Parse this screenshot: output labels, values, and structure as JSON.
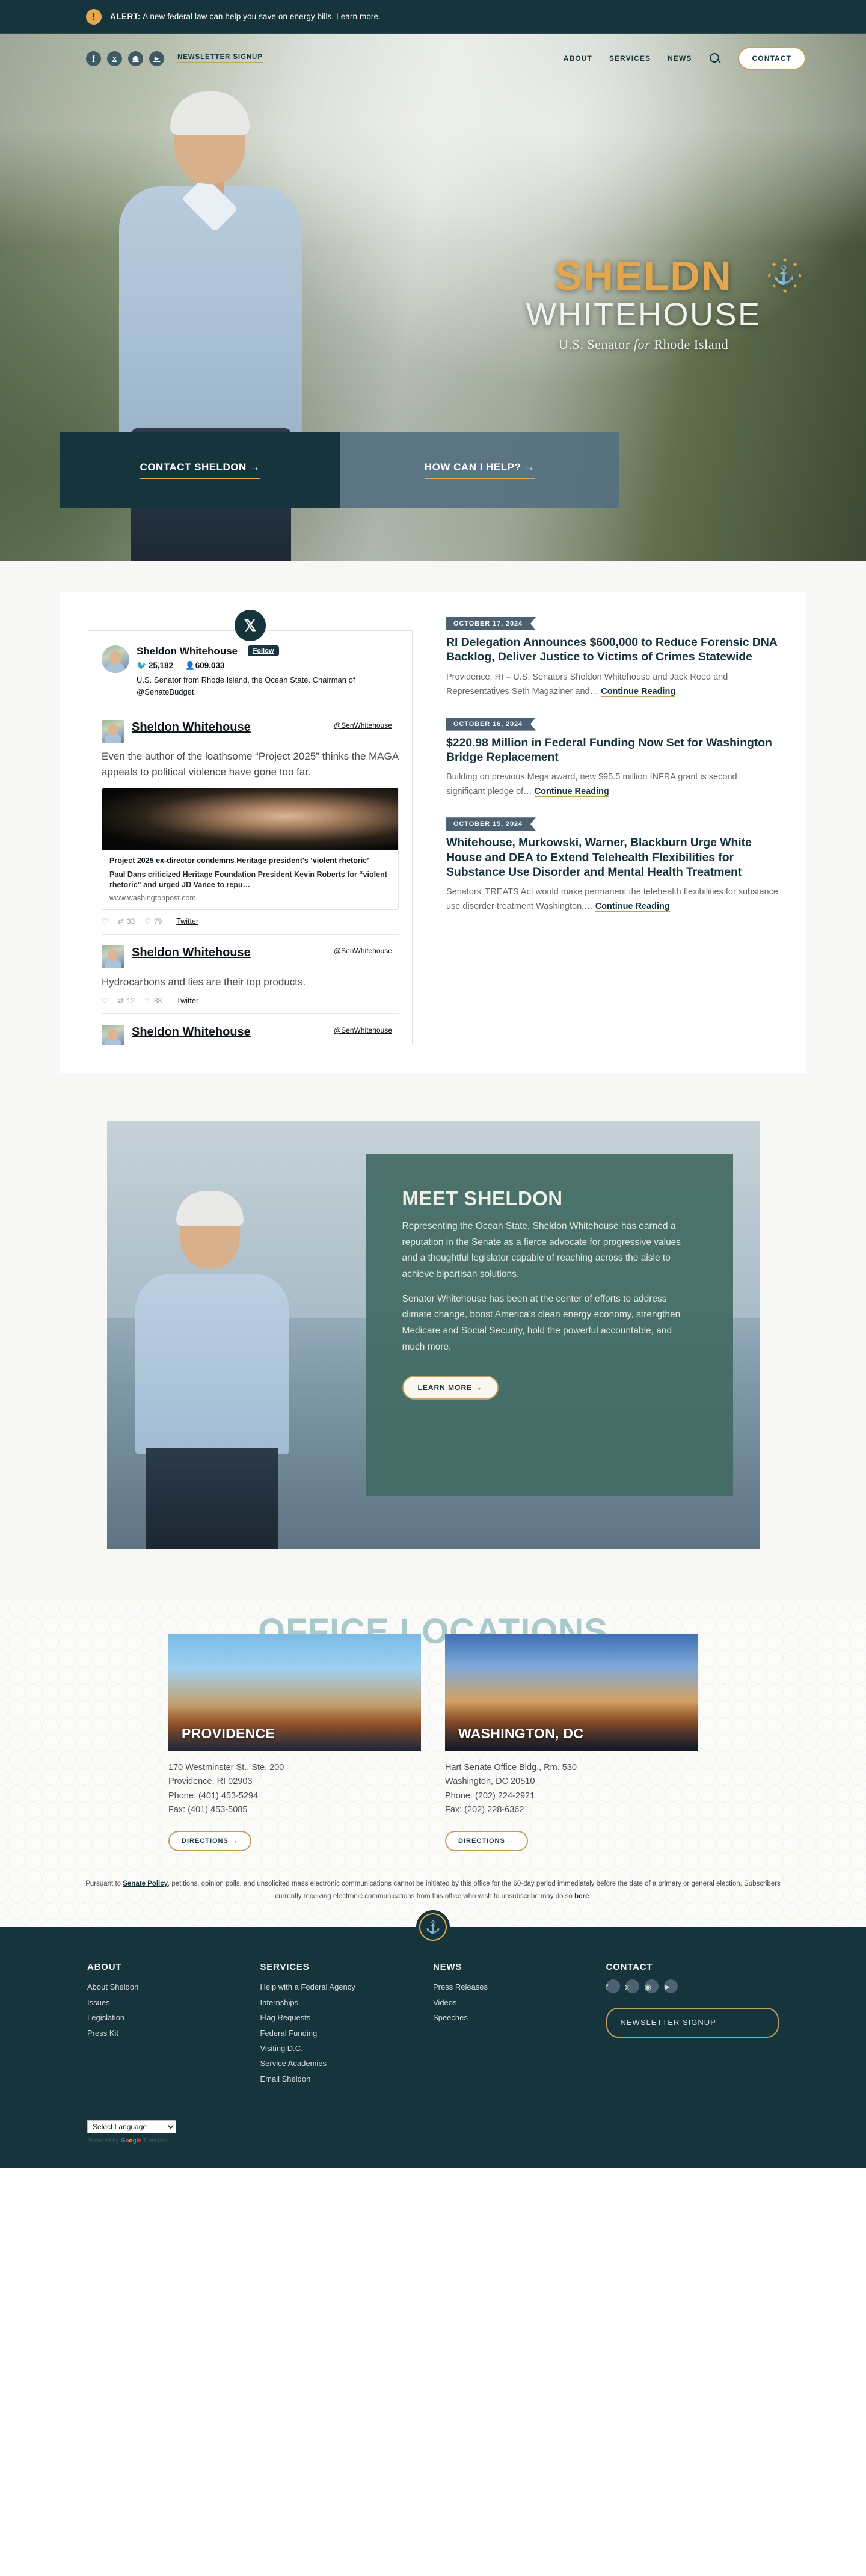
{
  "alert": {
    "icon": "exclamation-icon",
    "label": "ALERT:",
    "message": " A new federal law can help you save on energy bills. Learn more."
  },
  "nav": {
    "social": [
      {
        "name": "facebook-icon",
        "glyph": "f"
      },
      {
        "name": "x-icon",
        "glyph": "✕"
      },
      {
        "name": "instagram-icon",
        "glyph": "◎"
      },
      {
        "name": "youtube-icon",
        "glyph": "▶"
      }
    ],
    "newsletter_label": "NEWSLETTER SIGNUP",
    "items": [
      "ABOUT",
      "SERVICES",
      "NEWS"
    ],
    "search_icon": "search-icon",
    "contact_label": "CONTACT"
  },
  "hero": {
    "first_name": "SHELD",
    "first_name_tail": "N",
    "last_name": "WHITEHOUSE",
    "tagline_prefix": "U.S. Senator ",
    "tagline_italic": "for",
    "tagline_suffix": " Rhode Island",
    "cta_primary": "CONTACT SHELDON →",
    "cta_secondary": "HOW CAN I HELP? →"
  },
  "twitter": {
    "logo": "x-logo-icon",
    "profile": {
      "name": "Sheldon Whitehouse",
      "follow_label": "Follow",
      "tweets_count": "25,182",
      "followers_count": "609,033",
      "bio": "U.S. Senator from Rhode Island, the Ocean State. Chairman of @SenateBudget."
    },
    "tweets": [
      {
        "name": "Sheldon Whitehouse",
        "handle": "@SenWhitehouse",
        "text": "Even the author of the loathsome “Project 2025” thinks the MAGA appeals to political violence have gone too far.",
        "card": {
          "title": "Project 2025 ex-director condemns Heritage president's ‘violent rhetoric’",
          "desc": "Paul Dans criticized Heritage Foundation President Kevin Roberts for “violent rhetoric” and urged JD Vance to repu…",
          "url": "www.washingtonpost.com"
        },
        "retweets": "33",
        "likes": "79",
        "source": "Twitter"
      },
      {
        "name": "Sheldon Whitehouse",
        "handle": "@SenWhitehouse",
        "text": "Hydrocarbons and lies are their top products.",
        "retweets": "12",
        "likes": "88",
        "source": "Twitter"
      },
      {
        "name": "Sheldon Whitehouse",
        "handle": "@SenWhitehouse"
      }
    ]
  },
  "news": [
    {
      "date": "OCTOBER 17, 2024",
      "title": "RI Delegation Announces $600,000 to Reduce Forensic DNA Backlog, Deliver Justice to Victims of Crimes Statewide",
      "excerpt": "Providence, RI – U.S. Senators Sheldon Whitehouse and Jack Reed and Representatives Seth Magaziner and… ",
      "continue_label": "Continue Reading"
    },
    {
      "date": "OCTOBER 16, 2024",
      "title": "$220.98 Million in Federal Funding Now Set for Washington Bridge Replacement",
      "excerpt": "Building on previous Mega award, new $95.5 million INFRA grant is second significant pledge of… ",
      "continue_label": "Continue Reading"
    },
    {
      "date": "OCTOBER 15, 2024",
      "title": "Whitehouse, Murkowski, Warner, Blackburn Urge White House and DEA to Extend Telehealth Flexibilities for Substance Use Disorder and Mental Health Treatment",
      "excerpt": "Senators' TREATS Act would make permanent the telehealth flexibilities for substance use disorder treatment Washington,… ",
      "continue_label": "Continue Reading"
    }
  ],
  "meet": {
    "title": "MEET SHELDON",
    "paragraph1": "Representing the Ocean State, Sheldon Whitehouse has earned a reputation in the Senate as a fierce advocate for progressive values and a thoughtful legislator capable of reaching across the aisle to achieve bipartisan solutions.",
    "paragraph2": "Senator Whitehouse has been at the center of efforts to address climate change, boost America's clean energy economy, strengthen Medicare and Social Security, hold the powerful accountable, and much more.",
    "button_label": "LEARN MORE →"
  },
  "offices": {
    "heading": "OFFICE LOCATIONS",
    "items": [
      {
        "city": "PROVIDENCE",
        "address": "170 Westminster St., Ste. 200\nProvidence, RI 02903\nPhone: (401) 453-5294\nFax: (401) 453-5085",
        "button_label": "DIRECTIONS →"
      },
      {
        "city": "WASHINGTON, DC",
        "address": "Hart Senate Office Bldg., Rm. 530\nWashington, DC 20510\nPhone: (202) 224-2921\nFax: (202) 228-6362",
        "button_label": "DIRECTIONS →"
      }
    ],
    "disclaimer_pre": "Pursuant to ",
    "disclaimer_link1": "Senate Policy",
    "disclaimer_mid": ", petitions, opinion polls, and unsolicited mass electronic communications cannot be initiated by this office for the 60-day period immediately before the date of a primary or general election. Subscribers currently receiving electronic communications from this office who wish to unsubscribe may do so ",
    "disclaimer_link2": "here",
    "disclaimer_post": "."
  },
  "footer": {
    "seal_icon": "senate-seal-icon",
    "columns": [
      {
        "heading": "ABOUT",
        "links": [
          "About Sheldon",
          "Issues",
          "Legislation",
          "Press Kit"
        ]
      },
      {
        "heading": "SERVICES",
        "links": [
          "Help with a Federal Agency",
          "Internships",
          "Flag Requests",
          "Federal Funding",
          "Visiting D.C.",
          "Service Academies",
          "Email Sheldon"
        ]
      },
      {
        "heading": "NEWS",
        "links": [
          "Press Releases",
          "Videos",
          "Speeches"
        ]
      }
    ],
    "contact_heading": "CONTACT",
    "social": [
      {
        "name": "facebook-icon",
        "glyph": "f"
      },
      {
        "name": "x-icon",
        "glyph": "✕"
      },
      {
        "name": "instagram-icon",
        "glyph": "◎"
      },
      {
        "name": "youtube-icon",
        "glyph": "▶"
      }
    ],
    "newsletter_label": "NEWSLETTER SIGNUP",
    "language_selected": "Select Language",
    "powered_prefix": "Powered by ",
    "powered_brand": "Google",
    "powered_suffix": " Translate"
  },
  "colors": {
    "dark": "#16343c",
    "gold": "#c2a05c",
    "amber": "#e3a84f",
    "slate": "#4c6272",
    "teal_card": "#436a63"
  }
}
